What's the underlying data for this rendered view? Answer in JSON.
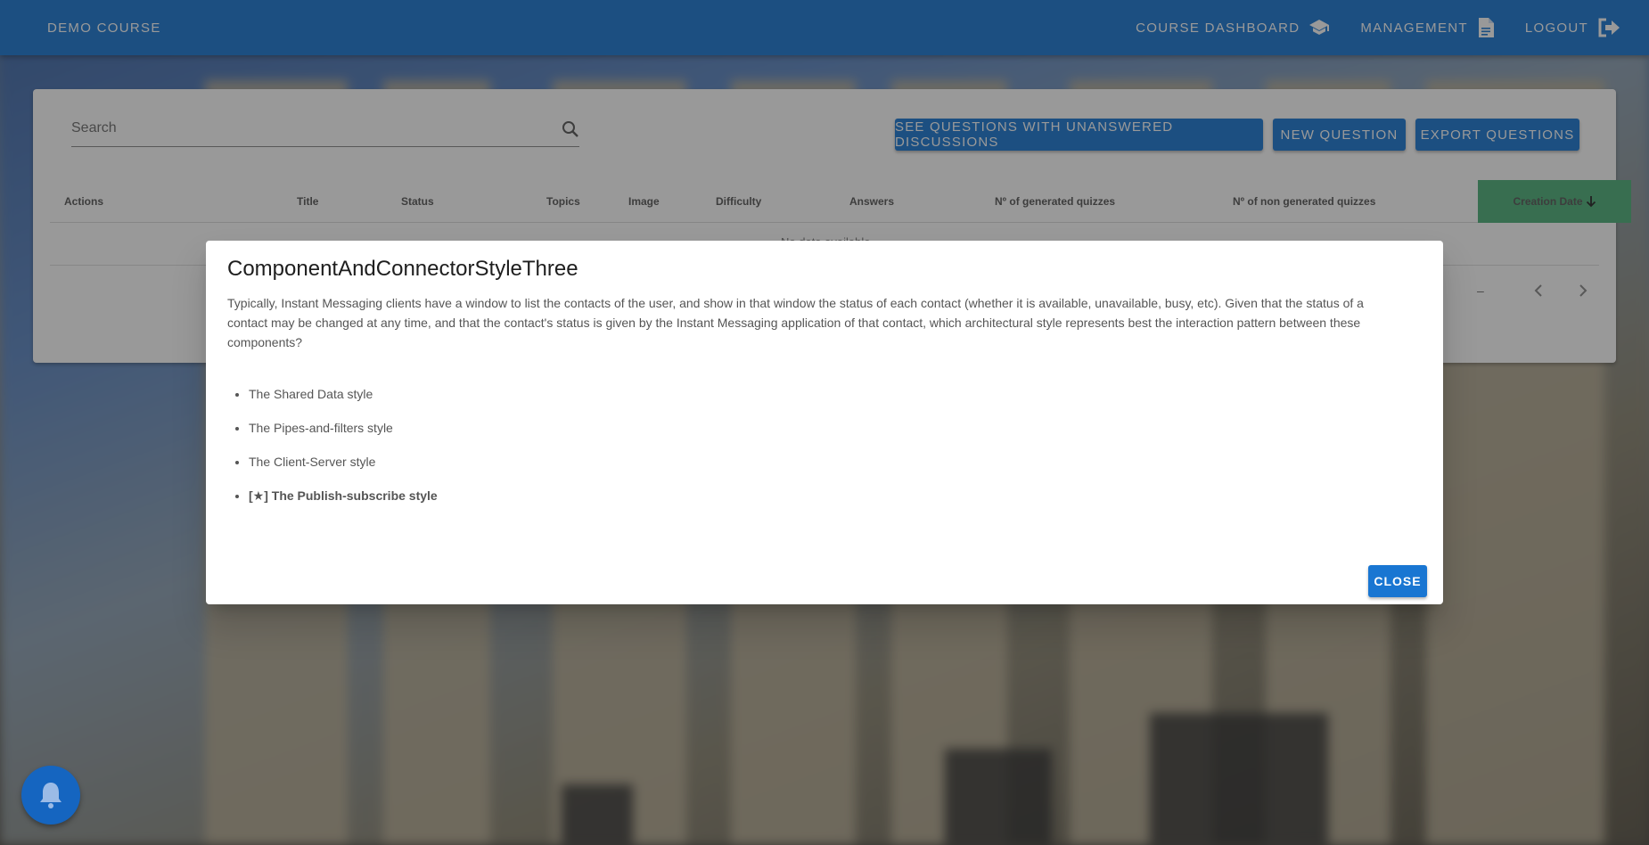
{
  "appbar": {
    "brand": "DEMO COURSE",
    "nav": [
      {
        "label": "COURSE DASHBOARD",
        "icon": "school-icon"
      },
      {
        "label": "MANAGEMENT",
        "icon": "document-icon"
      },
      {
        "label": "LOGOUT",
        "icon": "logout-icon"
      }
    ],
    "color": "#1976d2"
  },
  "toolbar": {
    "search_placeholder": "Search",
    "unanswered_label": "SEE QUESTIONS WITH UNANSWERED DISCUSSIONS",
    "new_question_label": "NEW QUESTION",
    "export_label": "EXPORT QUESTIONS"
  },
  "table": {
    "headers": [
      "Actions",
      "Title",
      "Status",
      "Topics",
      "Image",
      "Difficulty",
      "Answers",
      "Nº of generated quizzes",
      "Nº of non generated quizzes"
    ],
    "sorted_header": "Creation Date",
    "empty_text": "No data available",
    "pager_text": "–"
  },
  "dialog": {
    "title": "ComponentAndConnectorStyleThree",
    "question": "Typically, Instant Messaging clients have a window to list the contacts of the user, and show in that window the status of each contact (whether it is available, unavailable, busy, etc). Given that the status of a contact may be changed at any time, and that the contact's status is given by the Instant Messaging application of that contact, which architectural style represents best the interaction pattern between these components?",
    "options": [
      "The Shared Data style",
      "The Pipes-and-filters style",
      "The Client-Server style"
    ],
    "correct_option": "[★] The Publish-subscribe style",
    "close_label": "CLOSE"
  },
  "fab": {
    "icon": "bell-icon"
  }
}
